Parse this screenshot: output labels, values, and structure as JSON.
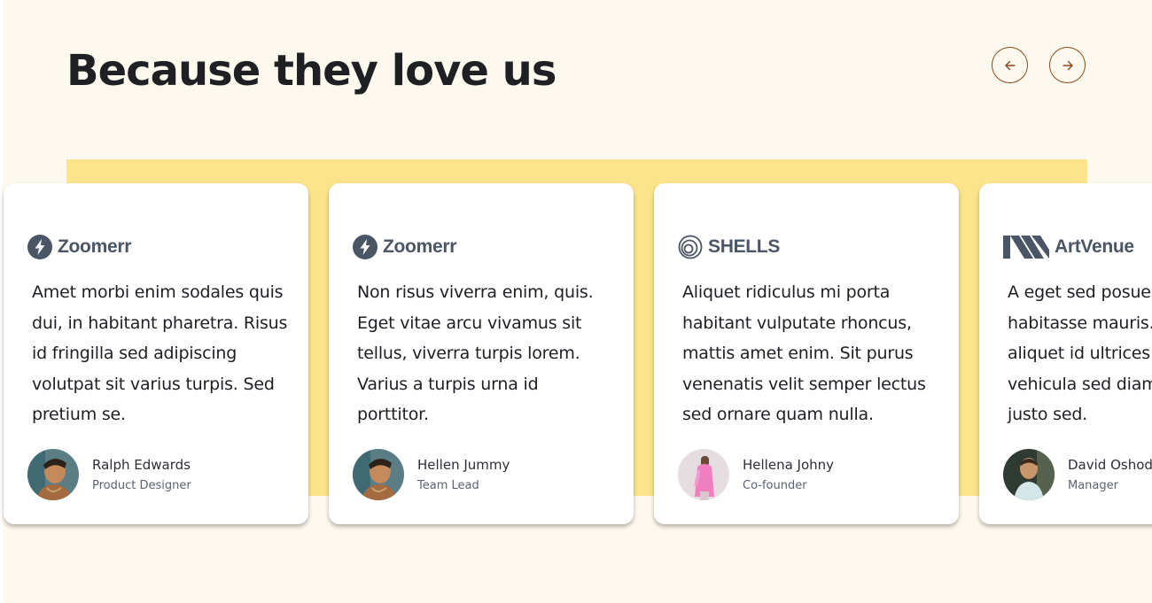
{
  "heading": "Because they love us",
  "nav": {
    "prev_icon": "arrow-left-icon",
    "next_icon": "arrow-right-icon",
    "accent": "#8a4b1c"
  },
  "colors": {
    "background": "#fef9ee",
    "band": "#fbe48c",
    "card": "#ffffff",
    "logo": "#4a5565"
  },
  "testimonials": [
    {
      "logo_icon": "bolt-circle-icon",
      "logo": "Zoomerr",
      "quote": "Amet morbi enim sodales quis dui, in habitant pharetra. Risus id fringilla sed adipiscing volutpat sit varius turpis. Sed pretium se.",
      "name": "Ralph Edwards",
      "role": "Product Designer"
    },
    {
      "logo_icon": "bolt-circle-icon",
      "logo": "Zoomerr",
      "quote": "Non risus viverra enim, quis. Eget vitae arcu vivamus sit tellus, viverra turpis lorem. Varius a turpis urna id porttitor.",
      "name": "Hellen Jummy",
      "role": "Team Lead"
    },
    {
      "logo_icon": "spiral-shell-icon",
      "logo": "SHELLS",
      "quote": "Aliquet ridiculus mi porta habitant vulputate rhoncus, mattis amet enim. Sit purus venenatis velit semper lectus sed ornare quam nulla.",
      "name": "Hellena Johny",
      "role": "Co-founder"
    },
    {
      "logo_icon": "artvenue-stripes-icon",
      "logo": "ArtVenue",
      "quote": "A eget sed posuere dui habitasse mauris. Magna aliquet id ultrices at. Pretium vehicula sed diam posuere justo sed.",
      "name": "David Oshodi",
      "role": "Manager"
    }
  ]
}
